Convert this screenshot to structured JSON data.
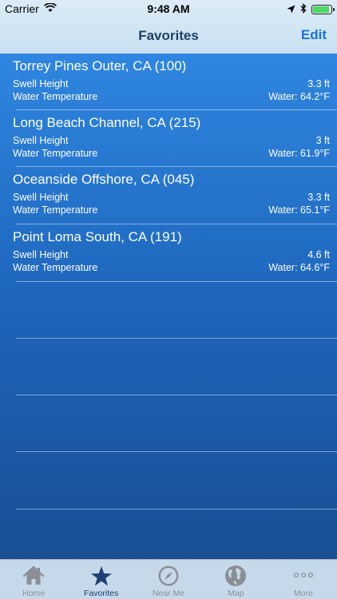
{
  "status_bar": {
    "carrier": "Carrier",
    "time": "9:48 AM",
    "battery_level": 0.92
  },
  "nav": {
    "title": "Favorites",
    "edit_label": "Edit"
  },
  "favorites": [
    {
      "name": "Torrey Pines Outer, CA (100)",
      "swell_label": "Swell Height",
      "swell_value": "3.3 ft",
      "temp_label": "Water Temperature",
      "temp_value": "Water: 64.2°F"
    },
    {
      "name": "Long Beach Channel, CA (215)",
      "swell_label": "Swell Height",
      "swell_value": "3 ft",
      "temp_label": "Water Temperature",
      "temp_value": "Water: 61.9°F"
    },
    {
      "name": "Oceanside Offshore, CA (045)",
      "swell_label": "Swell Height",
      "swell_value": "3.3 ft",
      "temp_label": "Water Temperature",
      "temp_value": "Water: 65.1°F"
    },
    {
      "name": "Point Loma South, CA  (191)",
      "swell_label": "Swell Height",
      "swell_value": "4.6 ft",
      "temp_label": "Water Temperature",
      "temp_value": "Water: 64.6°F"
    }
  ],
  "tabbar": {
    "active_index": 1,
    "tabs": [
      {
        "label": "Home",
        "icon": "home-icon"
      },
      {
        "label": "Favorites",
        "icon": "star-icon"
      },
      {
        "label": "Near Me",
        "icon": "compass-icon"
      },
      {
        "label": "Map",
        "icon": "globe-icon"
      },
      {
        "label": "More",
        "icon": "more-icon"
      }
    ]
  },
  "colors": {
    "list_top": "#2f86e0",
    "list_bottom": "#1a4f93",
    "nav_title": "#1f3f66",
    "edit_link": "#1a73d9",
    "tab_active": "#1e3f73",
    "tab_inactive": "#8a8f96"
  }
}
